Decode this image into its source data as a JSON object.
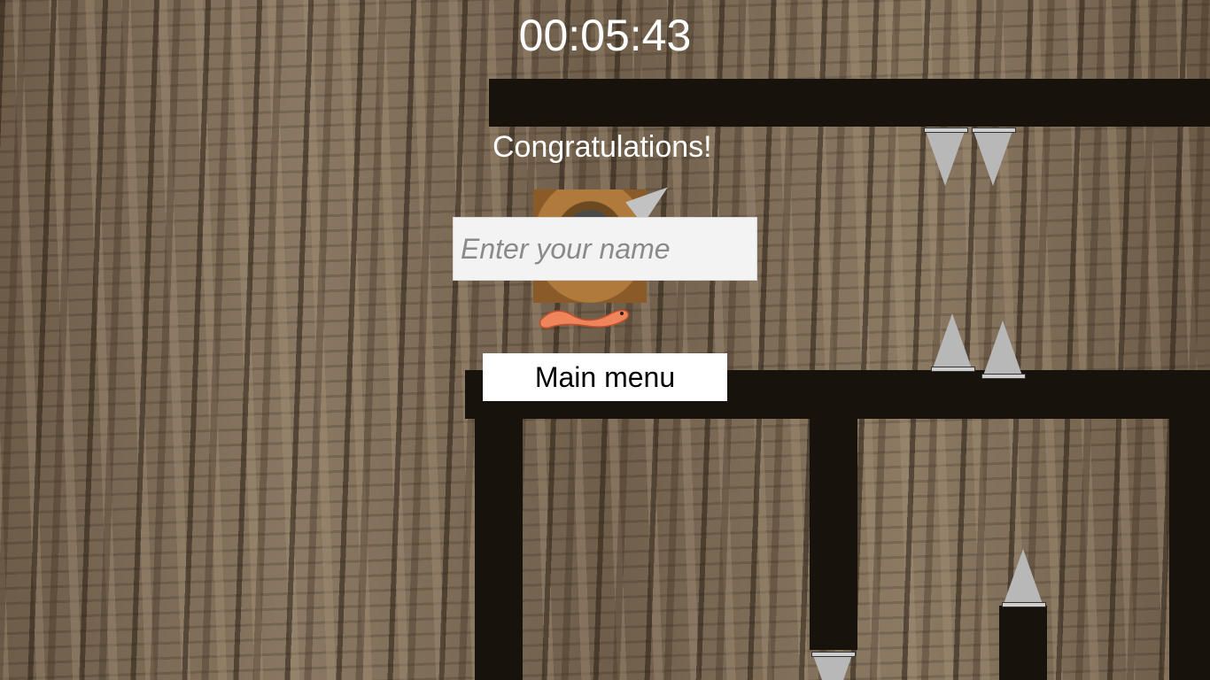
{
  "hud": {
    "timer": "00:05:43"
  },
  "dialog": {
    "title": "Congratulations!",
    "name_placeholder": "Enter your name",
    "name_value": "",
    "main_menu_label": "Main menu"
  },
  "colors": {
    "platform": "#17120c",
    "spike": "#b8b8b8",
    "text": "#ffffff",
    "button_bg": "#ffffff"
  },
  "icons": {
    "spike": "spike-icon",
    "player": "worm-player-icon",
    "stump": "tree-stump-icon"
  }
}
